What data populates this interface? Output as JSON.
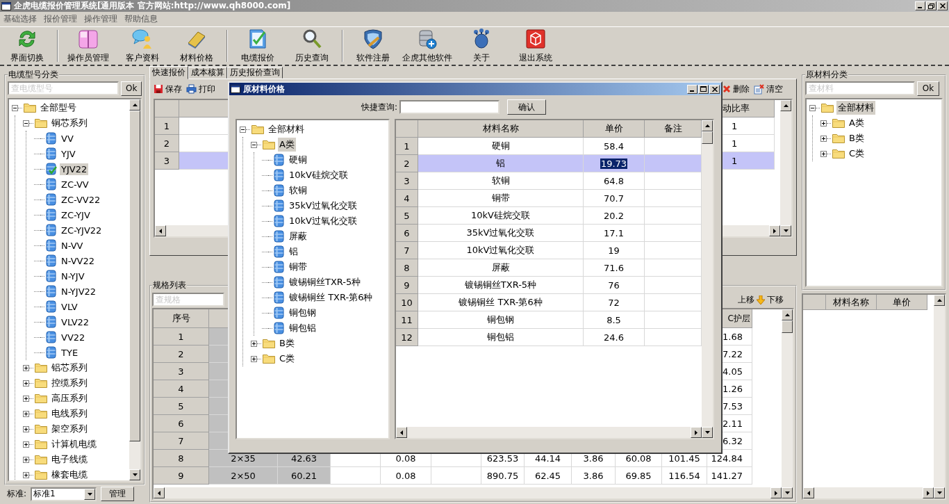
{
  "window": {
    "title": "企虎电缆报价管理系统[通用版本 官方网站:http://www.qh8000.com]"
  },
  "menu": [
    "基础选择",
    "报价管理",
    "操作管理",
    "帮助信息"
  ],
  "toolbar": [
    [
      {
        "label": "界面切换"
      }
    ],
    [
      {
        "label": "操作员管理"
      },
      {
        "label": "客户资料"
      },
      {
        "label": "材料价格"
      }
    ],
    [
      {
        "label": "电缆报价"
      },
      {
        "label": "历史查询"
      }
    ],
    [
      {
        "label": "软件注册"
      },
      {
        "label": "企虎其他软件"
      },
      {
        "label": "关于"
      },
      {
        "label": "退出系统"
      }
    ]
  ],
  "cable_panel": {
    "title": "电缆型号分类",
    "search_placeholder": "查电缆型号",
    "ok_button": "Ok",
    "tree": [
      {
        "label": "全部型号",
        "kind": "folder",
        "expanded": true,
        "selected": false,
        "children": [
          {
            "label": "铜芯系列",
            "kind": "folder",
            "expanded": true,
            "selected": false,
            "children": [
              {
                "label": "VV",
                "kind": "cable",
                "selected": false
              },
              {
                "label": "YJV",
                "kind": "cable",
                "selected": false
              },
              {
                "label": "YJV22",
                "kind": "cable",
                "selected": true
              },
              {
                "label": "ZC-VV",
                "kind": "cable",
                "selected": false
              },
              {
                "label": "ZC-VV22",
                "kind": "cable",
                "selected": false
              },
              {
                "label": "ZC-YJV",
                "kind": "cable",
                "selected": false
              },
              {
                "label": "ZC-YJV22",
                "kind": "cable",
                "selected": false
              },
              {
                "label": "N-VV",
                "kind": "cable",
                "selected": false
              },
              {
                "label": "N-VV22",
                "kind": "cable",
                "selected": false
              },
              {
                "label": "N-YJV",
                "kind": "cable",
                "selected": false
              },
              {
                "label": "N-YJV22",
                "kind": "cable",
                "selected": false
              },
              {
                "label": "VLV",
                "kind": "cable",
                "selected": false
              },
              {
                "label": "VLV22",
                "kind": "cable",
                "selected": false
              },
              {
                "label": "VV22",
                "kind": "cable",
                "selected": false
              },
              {
                "label": "TYE",
                "kind": "cable",
                "selected": false
              }
            ]
          },
          {
            "label": "铝芯系列",
            "kind": "folder",
            "expanded": false,
            "selected": false
          },
          {
            "label": "控缆系列",
            "kind": "folder",
            "expanded": false,
            "selected": false
          },
          {
            "label": "高压系列",
            "kind": "folder",
            "expanded": false,
            "selected": false
          },
          {
            "label": "电线系列",
            "kind": "folder",
            "expanded": false,
            "selected": false
          },
          {
            "label": "架空系列",
            "kind": "folder",
            "expanded": false,
            "selected": false
          },
          {
            "label": "计算机电缆",
            "kind": "folder",
            "expanded": false,
            "selected": false
          },
          {
            "label": "电子线缆",
            "kind": "folder",
            "expanded": false,
            "selected": false
          },
          {
            "label": "橡套电缆",
            "kind": "folder",
            "expanded": false,
            "selected": false
          }
        ]
      }
    ],
    "standard_label": "标准:",
    "standard_value": "标准1",
    "manage_button": "管理"
  },
  "tabs": [
    {
      "label": "快速报价",
      "selected": true
    },
    {
      "label": "成本核算",
      "selected": false
    },
    {
      "label": "历史报价查询",
      "selected": false
    }
  ],
  "quote_toolbar": {
    "left": [
      "保存",
      "打印"
    ],
    "right": [
      "删除",
      "清空"
    ]
  },
  "quote_table": {
    "columns": [
      "动比率"
    ],
    "rows": [
      {
        "number": "1",
        "cells": [
          "1"
        ],
        "selected": false
      },
      {
        "number": "2",
        "cells": [
          "1"
        ],
        "selected": false
      },
      {
        "number": "3",
        "cells": [
          "1"
        ],
        "selected": true
      }
    ]
  },
  "spec_panel": {
    "title": "规格列表",
    "search_placeholder": "查规格",
    "actions": [
      {
        "label": "上移",
        "icon": false
      },
      {
        "label": "下移",
        "icon": true
      }
    ],
    "table": {
      "row_header": "序号",
      "columns": [
        "C护层"
      ],
      "rows": [
        {
          "number": "1",
          "cells": [
            "1.68"
          ]
        },
        {
          "number": "2",
          "cells": [
            "7.22"
          ]
        },
        {
          "number": "3",
          "cells": [
            "4.05"
          ]
        },
        {
          "number": "4",
          "cells": [
            "1.26"
          ]
        },
        {
          "number": "5",
          "cells": [
            "7.53"
          ]
        },
        {
          "number": "6",
          "cells": [
            "2.11"
          ]
        },
        {
          "number": "7",
          "cells": [
            "6.32"
          ]
        },
        {
          "number": "8",
          "cells": [
            "2×35",
            "42.63",
            null,
            "0.08",
            null,
            "623.53",
            "44.14",
            "3.86",
            "60.08",
            "101.45",
            "124.84"
          ]
        },
        {
          "number": "9",
          "cells": [
            "2×50",
            "60.21",
            null,
            "0.08",
            null,
            "890.75",
            "62.45",
            "3.86",
            "69.85",
            "116.54",
            "141.27"
          ]
        }
      ]
    }
  },
  "material_panel": {
    "title": "原材料分类",
    "search_placeholder": "查材料",
    "ok_button": "Ok",
    "tree": [
      {
        "label": "全部材料",
        "kind": "folder",
        "expanded": true,
        "selected": true,
        "children": [
          {
            "label": "A类",
            "kind": "folder",
            "expanded": false,
            "selected": false
          },
          {
            "label": "B类",
            "kind": "folder",
            "expanded": false,
            "selected": false
          },
          {
            "label": "C类",
            "kind": "folder",
            "expanded": false,
            "selected": false
          }
        ]
      }
    ],
    "table": {
      "columns": [
        "材料名称",
        "单价"
      ]
    }
  },
  "dialog": {
    "title": "原材料价格",
    "search_label": "快捷查询:",
    "confirm_button": "确认",
    "tree": [
      {
        "label": "全部材料",
        "kind": "folder",
        "expanded": true,
        "selected": false,
        "children": [
          {
            "label": "A类",
            "kind": "folder",
            "expanded": true,
            "selected": true,
            "children": [
              {
                "label": "硬铜",
                "kind": "cable",
                "selected": false
              },
              {
                "label": "10kV硅烷交联",
                "kind": "cable",
                "selected": false
              },
              {
                "label": "软铜",
                "kind": "cable",
                "selected": false
              },
              {
                "label": "35kV过氧化交联",
                "kind": "cable",
                "selected": false
              },
              {
                "label": "10kV过氧化交联",
                "kind": "cable",
                "selected": false
              },
              {
                "label": "屏蔽",
                "kind": "cable",
                "selected": false
              },
              {
                "label": "铝",
                "kind": "cable",
                "selected": false
              },
              {
                "label": "铜带",
                "kind": "cable",
                "selected": false
              },
              {
                "label": "镀锡铜丝TXR-5种",
                "kind": "cable",
                "selected": false
              },
              {
                "label": "镀锡铜丝 TXR-第6种",
                "kind": "cable",
                "selected": false
              },
              {
                "label": "铜包钢",
                "kind": "cable",
                "selected": false
              },
              {
                "label": "铜包铝",
                "kind": "cable",
                "selected": false
              }
            ]
          },
          {
            "label": "B类",
            "kind": "folder",
            "expanded": false,
            "selected": false
          },
          {
            "label": "C类",
            "kind": "folder",
            "expanded": false,
            "selected": false
          }
        ]
      }
    ],
    "table": {
      "columns": [
        "材料名称",
        "单价",
        "备注"
      ],
      "rows": [
        {
          "number": "1",
          "name": "硬铜",
          "price": "58.4",
          "selected": false
        },
        {
          "number": "2",
          "name": "铝",
          "price": "19.73",
          "selected": true
        },
        {
          "number": "3",
          "name": "软铜",
          "price": "64.8",
          "selected": false
        },
        {
          "number": "4",
          "name": "铜带",
          "price": "70.7",
          "selected": false
        },
        {
          "number": "5",
          "name": "10kV硅烷交联",
          "price": "20.2",
          "selected": false
        },
        {
          "number": "6",
          "name": "35kV过氧化交联",
          "price": "17.1",
          "selected": false
        },
        {
          "number": "7",
          "name": "10kV过氧化交联",
          "price": "19",
          "selected": false
        },
        {
          "number": "8",
          "name": "屏蔽",
          "price": "71.6",
          "selected": false
        },
        {
          "number": "9",
          "name": "镀锡铜丝TXR-5种",
          "price": "76",
          "selected": false
        },
        {
          "number": "10",
          "name": "镀锡铜丝 TXR-第6种",
          "price": "72",
          "selected": false
        },
        {
          "number": "11",
          "name": "铜包钢",
          "price": "8.5",
          "selected": false
        },
        {
          "number": "12",
          "name": "铜包铝",
          "price": "24.6",
          "selected": false
        }
      ]
    }
  }
}
